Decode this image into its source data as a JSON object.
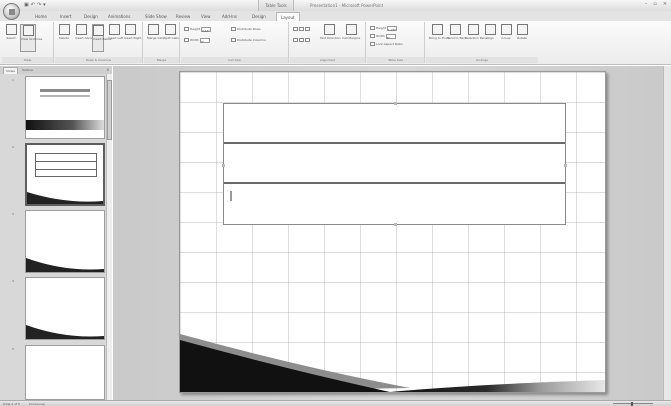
{
  "title_bar": {
    "context_group": "Table Tools",
    "document_title": "Presentation1 - Microsoft PowerPoint",
    "qat_icons": [
      "save-icon",
      "undo-icon",
      "redo-icon",
      "customize-icon"
    ]
  },
  "tabs": [
    {
      "label": "Home",
      "active": false
    },
    {
      "label": "Insert",
      "active": false
    },
    {
      "label": "Design",
      "active": false
    },
    {
      "label": "Animations",
      "active": false
    },
    {
      "label": "Slide Show",
      "active": false
    },
    {
      "label": "Review",
      "active": false
    },
    {
      "label": "View",
      "active": false
    },
    {
      "label": "Add-Ins",
      "active": false
    },
    {
      "label": "Design",
      "active": false
    },
    {
      "label": "Layout",
      "active": true
    }
  ],
  "ribbon": {
    "table_group": {
      "label": "Table",
      "buttons": [
        "Select",
        "View Gridlines"
      ]
    },
    "rows_columns_group": {
      "label": "Rows & Columns",
      "buttons": [
        "Delete",
        "Insert Above",
        "Insert Below",
        "Insert Left",
        "Insert Right"
      ]
    },
    "merge_group": {
      "label": "Merge",
      "buttons": [
        "Merge Cells",
        "Split Cells"
      ]
    },
    "cell_size_group": {
      "label": "Cell Size",
      "height_label": "Height",
      "height_value": "0.65\"",
      "width_label": "Width",
      "width_value": "0\"",
      "distribute_rows": "Distribute Rows",
      "distribute_columns": "Distribute Columns"
    },
    "alignment_group": {
      "label": "Alignment",
      "buttons": [
        "Text Direction",
        "Cell Margins"
      ]
    },
    "table_size_group": {
      "label": "Table Size",
      "height_label": "Height",
      "height_value": "1.96\"",
      "width_label": "Width",
      "width_value": "8\"",
      "lock": "Lock Aspect Ratio"
    },
    "arrange_group": {
      "label": "Arrange",
      "buttons": [
        "Bring to Front",
        "Send to Back",
        "Selection Pane",
        "Align",
        "Group",
        "Rotate"
      ]
    }
  },
  "left_pane": {
    "tabs": [
      {
        "label": "Slides",
        "active": true
      },
      {
        "label": "Outline",
        "active": false
      }
    ],
    "close": "x",
    "slides": [
      {
        "number": "1",
        "selected": false
      },
      {
        "number": "2",
        "selected": true
      },
      {
        "number": "3",
        "selected": false
      },
      {
        "number": "4",
        "selected": false
      },
      {
        "number": "5",
        "selected": false
      }
    ]
  },
  "status_bar": {
    "slide_info": "Slide 2 of 5",
    "theme": "Concourse"
  },
  "colors": {
    "ribbon_bg": "#f2f2f2",
    "canvas_bg": "#d2d2d2",
    "swoosh_dark": "#1a1a1a"
  }
}
